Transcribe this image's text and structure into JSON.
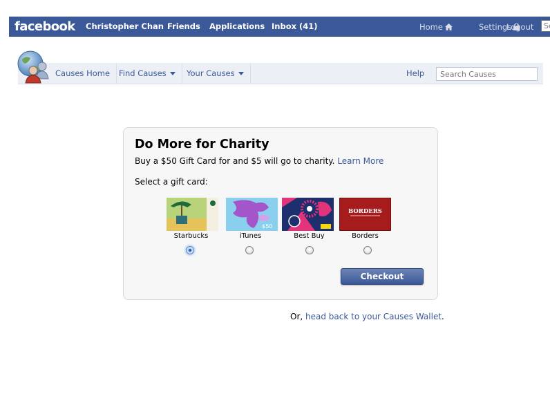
{
  "topbar": {
    "logo": "facebook",
    "nav": [
      "Christopher Chan",
      "Friends",
      "Applications",
      "Inbox (41)"
    ],
    "home": "Home",
    "settings": "Settings",
    "logout": "Logout",
    "search_placeholder": "Search",
    "color": "#3b5998"
  },
  "causes_nav": {
    "home": "Causes Home",
    "find": "Find Causes",
    "yours": "Your Causes",
    "help": "Help",
    "search_placeholder": "Search Causes"
  },
  "panel": {
    "title": "Do More for Charity",
    "description": "Buy a $50 Gift Card for and $5 will go to charity.",
    "learn_more": "Learn More",
    "select_label": "Select a gift card:",
    "cards": [
      {
        "name": "Starbucks",
        "selected": true
      },
      {
        "name": "iTunes",
        "selected": false
      },
      {
        "name": "Best Buy",
        "selected": false
      },
      {
        "name": "Borders",
        "selected": false
      }
    ],
    "itunes_value": "$50",
    "borders_logo": "BORDERS",
    "checkout": "Checkout"
  },
  "footer": {
    "prefix": "Or,",
    "link": "head back to your Causes Wallet",
    "suffix": "."
  }
}
